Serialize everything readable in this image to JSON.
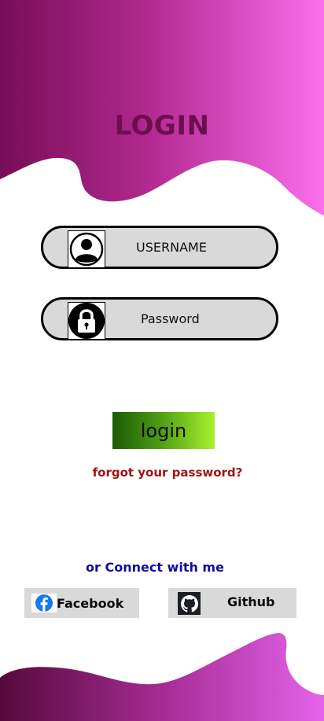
{
  "header": {
    "title": "LOGIN"
  },
  "form": {
    "username_label": "USERNAME",
    "password_label": "Password",
    "login_label": "login",
    "forgot_label": "forgot your password?"
  },
  "social": {
    "heading": "or Connect with me",
    "facebook_label": "Facebook",
    "github_label": "Github"
  },
  "icons": {
    "username": "user-icon",
    "password": "lock-icon",
    "facebook": "facebook-icon",
    "github": "github-icon"
  },
  "colors": {
    "title": "#6b0f4e",
    "top_gradient_start": "#7a0f5a",
    "top_gradient_end": "#f86de8",
    "bottom_gradient_start": "#5a0b3f",
    "bottom_gradient_end": "#e061e6",
    "field_bg": "#d9d9d9",
    "login_button_start": "#1c5b07",
    "login_button_end": "#a7f22c",
    "forgot_text": "#a01414",
    "connect_text": "#0f0f99",
    "facebook_blue": "#1877f2"
  }
}
